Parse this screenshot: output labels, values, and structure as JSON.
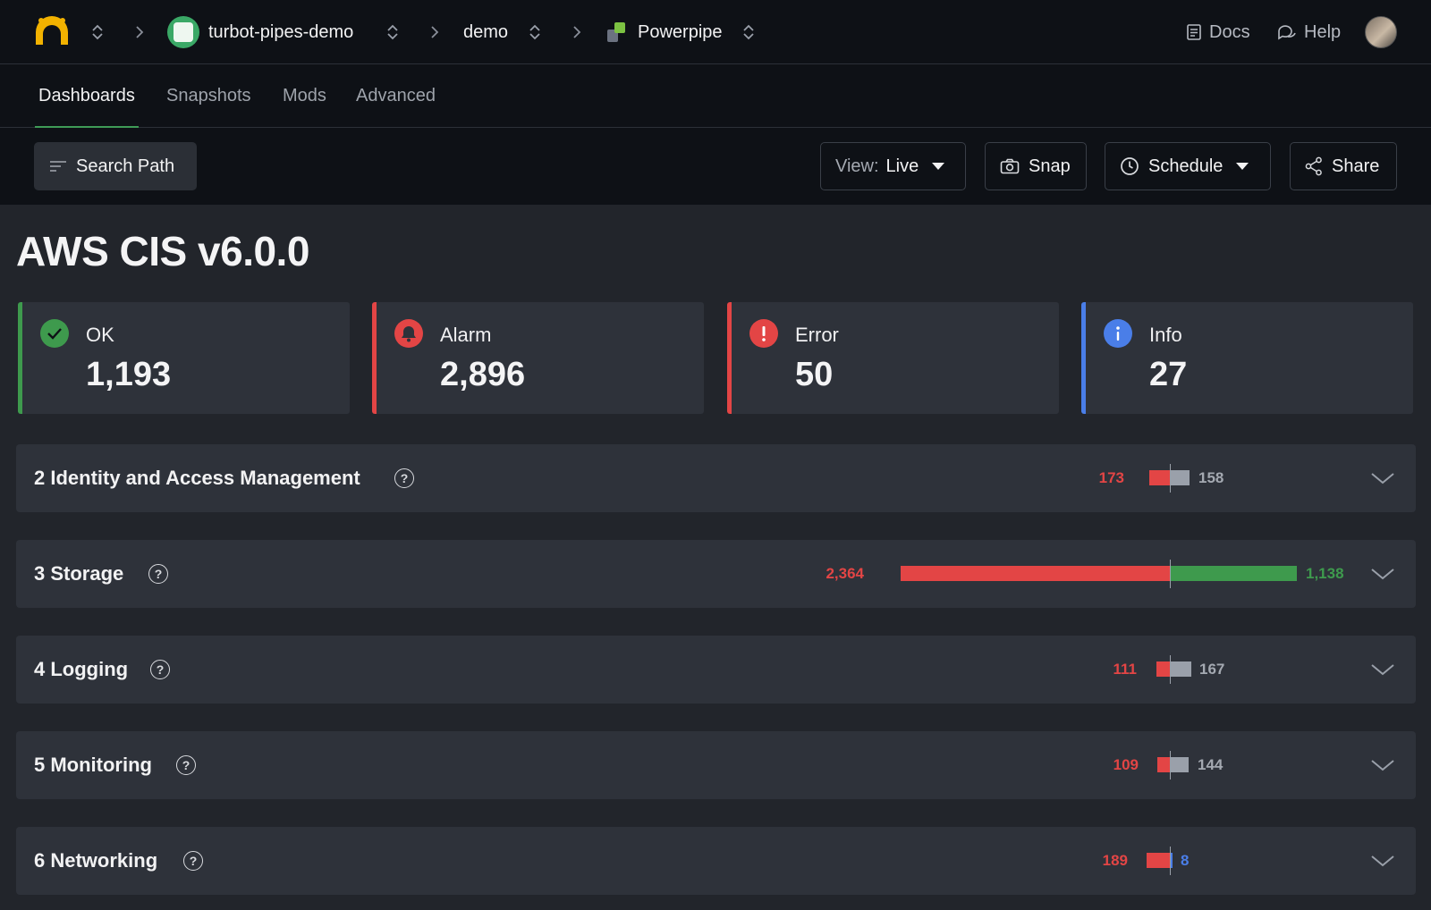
{
  "topbar": {
    "workspace": "turbot-pipes-demo",
    "project": "demo",
    "product": "Powerpipe",
    "docs": "Docs",
    "help": "Help"
  },
  "tabs": [
    {
      "label": "Dashboards",
      "active": true
    },
    {
      "label": "Snapshots",
      "active": false
    },
    {
      "label": "Mods",
      "active": false
    },
    {
      "label": "Advanced",
      "active": false
    }
  ],
  "toolbar": {
    "search_path": "Search Path",
    "view_prefix": "View:",
    "view_value": "Live",
    "snap": "Snap",
    "schedule": "Schedule",
    "share": "Share"
  },
  "page": {
    "title": "AWS CIS v6.0.0"
  },
  "summary": [
    {
      "label": "OK",
      "value": "1,193",
      "color": "#3e9a4d",
      "icon": "check-circle-icon"
    },
    {
      "label": "Alarm",
      "value": "2,896",
      "color": "#e34545",
      "icon": "bell-icon"
    },
    {
      "label": "Error",
      "value": "50",
      "color": "#e34545",
      "icon": "exclamation-icon"
    },
    {
      "label": "Info",
      "value": "27",
      "color": "#4a7ee8",
      "icon": "info-icon"
    }
  ],
  "sections": [
    {
      "title": "2 Identity and Access Management",
      "left_value": "173",
      "right_value": "158",
      "right_color": "gray",
      "alarm_fraction": 0.05,
      "right_fraction": 0.05
    },
    {
      "title": "3 Storage",
      "left_value": "2,364",
      "right_value": "1,138",
      "right_color": "green",
      "alarm_fraction": 0.68,
      "right_fraction": 0.32
    },
    {
      "title": "4 Logging",
      "left_value": "111",
      "right_value": "167",
      "right_color": "gray",
      "alarm_fraction": 0.035,
      "right_fraction": 0.05
    },
    {
      "title": "5 Monitoring",
      "left_value": "109",
      "right_value": "144",
      "right_color": "gray",
      "alarm_fraction": 0.03,
      "right_fraction": 0.045
    },
    {
      "title": "6 Networking",
      "left_value": "189",
      "right_value": "8",
      "right_color": "blue",
      "alarm_fraction": 0.055,
      "right_fraction": 0.005
    }
  ],
  "colors": {
    "ok": "#3e9a4d",
    "alarm": "#e34545",
    "info": "#4a7ee8",
    "skip": "#9aa0aa"
  }
}
